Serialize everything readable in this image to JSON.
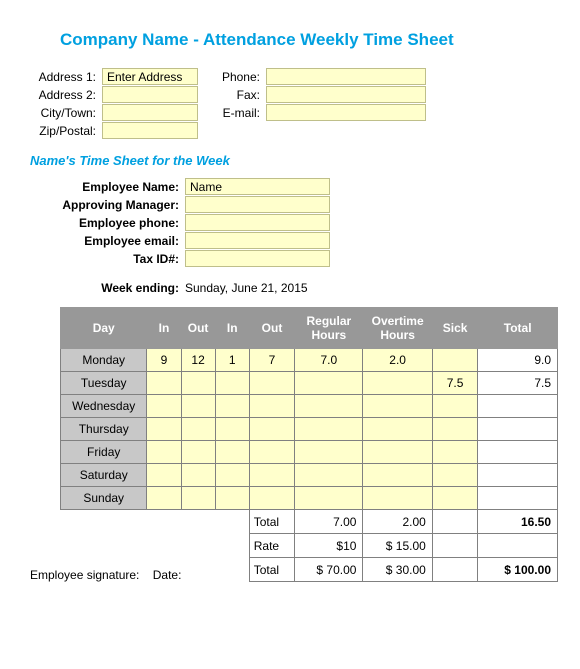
{
  "title": "Company Name - Attendance Weekly Time Sheet",
  "addr": {
    "a1_label": "Address 1:",
    "a1_value": "Enter Address",
    "a2_label": "Address 2:",
    "a2_value": "",
    "city_label": "City/Town:",
    "city_value": "",
    "zip_label": "Zip/Postal:",
    "zip_value": "",
    "phone_label": "Phone:",
    "phone_value": "",
    "fax_label": "Fax:",
    "fax_value": "",
    "email_label": "E-mail:",
    "email_value": ""
  },
  "subtitle": "Name's Time Sheet for the Week",
  "emp": {
    "name_label": "Employee Name:",
    "name_value": "Name",
    "mgr_label": "Approving Manager:",
    "mgr_value": "",
    "phone_label": "Employee phone:",
    "phone_value": "",
    "email_label": "Employee email:",
    "email_value": "",
    "tax_label": "Tax ID#:",
    "tax_value": ""
  },
  "week": {
    "label": "Week ending:",
    "value": "Sunday, June 21, 2015"
  },
  "headers": {
    "day": "Day",
    "in1": "In",
    "out1": "Out",
    "in2": "In",
    "out2": "Out",
    "reg": "Regular Hours",
    "ot": "Overtime Hours",
    "sick": "Sick",
    "total": "Total"
  },
  "days": [
    {
      "name": "Monday",
      "in1": "9",
      "out1": "12",
      "in2": "1",
      "out2": "7",
      "reg": "7.0",
      "ot": "2.0",
      "sick": "",
      "total": "9.0"
    },
    {
      "name": "Tuesday",
      "in1": "",
      "out1": "",
      "in2": "",
      "out2": "",
      "reg": "",
      "ot": "",
      "sick": "7.5",
      "total": "7.5"
    },
    {
      "name": "Wednesday",
      "in1": "",
      "out1": "",
      "in2": "",
      "out2": "",
      "reg": "",
      "ot": "",
      "sick": "",
      "total": ""
    },
    {
      "name": "Thursday",
      "in1": "",
      "out1": "",
      "in2": "",
      "out2": "",
      "reg": "",
      "ot": "",
      "sick": "",
      "total": ""
    },
    {
      "name": "Friday",
      "in1": "",
      "out1": "",
      "in2": "",
      "out2": "",
      "reg": "",
      "ot": "",
      "sick": "",
      "total": ""
    },
    {
      "name": "Saturday",
      "in1": "",
      "out1": "",
      "in2": "",
      "out2": "",
      "reg": "",
      "ot": "",
      "sick": "",
      "total": ""
    },
    {
      "name": "Sunday",
      "in1": "",
      "out1": "",
      "in2": "",
      "out2": "",
      "reg": "",
      "ot": "",
      "sick": "",
      "total": ""
    }
  ],
  "summary": {
    "total_label": "Total",
    "total_reg": "7.00",
    "total_ot": "2.00",
    "total_sick": "",
    "total_total": "16.50",
    "rate_label": "Rate",
    "rate_reg": "$10",
    "rate_ot": "$    15.00",
    "rate_sick": "",
    "rate_total": "",
    "gtotal_label": "Total",
    "gtotal_reg": "$   70.00",
    "gtotal_ot": "$    30.00",
    "gtotal_sick": "",
    "gtotal_total": "$   100.00"
  },
  "signature": {
    "emp": "Employee signature:",
    "date": "Date:"
  }
}
